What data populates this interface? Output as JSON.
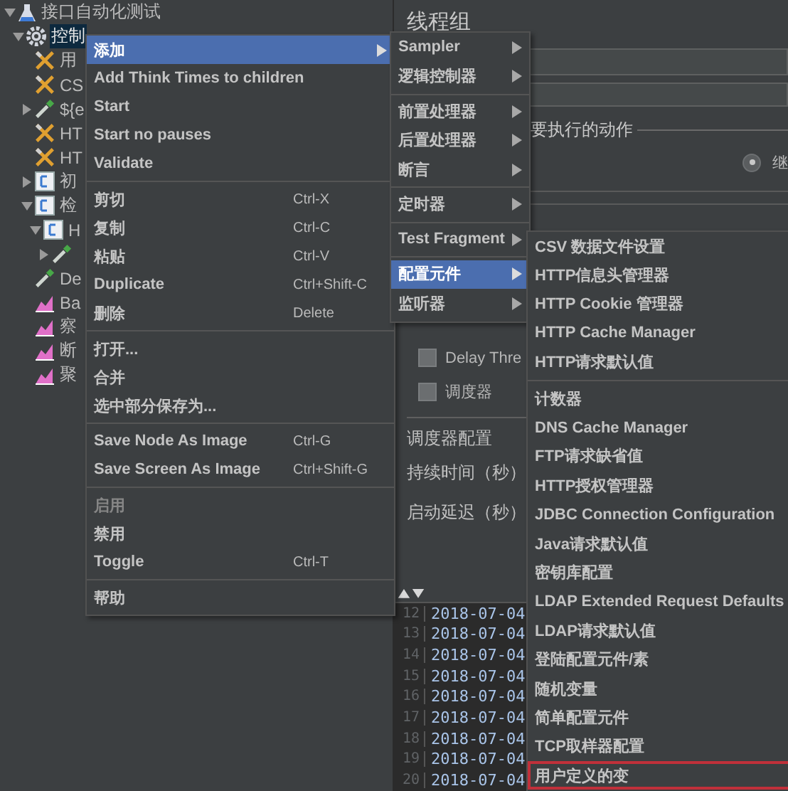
{
  "tree": [
    {
      "label": "接口自动化测试",
      "kind": "flask",
      "expanded": true,
      "selected": false,
      "children": [
        {
          "label": "控制",
          "kind": "gear",
          "expanded": true,
          "selected": true,
          "children": [
            {
              "label": "用",
              "kind": "tools",
              "selected": false
            },
            {
              "label": "CS",
              "kind": "tools",
              "selected": false
            },
            {
              "label": "${e",
              "kind": "pipette",
              "expanded": false,
              "selected": false
            },
            {
              "label": "HT",
              "kind": "tools",
              "selected": false
            },
            {
              "label": "HT",
              "kind": "tools",
              "selected": false
            },
            {
              "label": "初",
              "kind": "controller",
              "expanded": false,
              "selected": false
            },
            {
              "label": "检",
              "kind": "controller",
              "expanded": true,
              "selected": false,
              "children": [
                {
                  "label": "H",
                  "kind": "controller",
                  "expanded": true,
                  "selected": false,
                  "children": [
                    {
                      "kind": "pipette",
                      "expanded": false
                    }
                  ]
                }
              ]
            },
            {
              "label": "De",
              "kind": "pipette",
              "selected": false
            },
            {
              "label": "Ba",
              "kind": "chart",
              "selected": false
            },
            {
              "label": "察",
              "kind": "chart",
              "selected": false
            },
            {
              "label": "断",
              "kind": "chart",
              "selected": false
            },
            {
              "label": "聚",
              "kind": "chart",
              "selected": false
            }
          ]
        }
      ]
    }
  ],
  "panel": {
    "title": "线程组",
    "action_group": "要执行的动作",
    "radio": {
      "label": "继",
      "selected": true
    },
    "options": [
      {
        "label": "Delay Thre",
        "checked": false
      },
      {
        "label": "调度器",
        "checked": false
      }
    ],
    "scheduler_group": "调度器配置",
    "fields": [
      "持续时间（秒）",
      "启动延迟（秒）"
    ]
  },
  "log": [
    {
      "line": "12",
      "text": "2018-07-04"
    },
    {
      "line": "13",
      "text": "2018-07-04"
    },
    {
      "line": "14",
      "text": "2018-07-04"
    },
    {
      "line": "15",
      "text": "2018-07-04"
    },
    {
      "line": "16",
      "text": "2018-07-04"
    },
    {
      "line": "17",
      "text": "2018-07-04"
    },
    {
      "line": "18",
      "text": "2018-07-04"
    },
    {
      "line": "19",
      "text": "2018-07-04"
    },
    {
      "line": "20",
      "text": "2018-07-04"
    }
  ],
  "context_menu": [
    {
      "kind": "submenu",
      "label": "添加",
      "selected": true
    },
    {
      "kind": "item",
      "label": "Add Think Times to children",
      "selected": false
    },
    {
      "kind": "item",
      "label": "Start",
      "selected": false
    },
    {
      "kind": "item",
      "label": "Start no pauses",
      "selected": false
    },
    {
      "kind": "item",
      "label": "Validate",
      "selected": false
    },
    {
      "kind": "separator"
    },
    {
      "kind": "item",
      "label": "剪切",
      "shortcut": "Ctrl-X",
      "selected": false
    },
    {
      "kind": "item",
      "label": "复制",
      "shortcut": "Ctrl-C",
      "selected": false
    },
    {
      "kind": "item",
      "label": "粘贴",
      "shortcut": "Ctrl-V",
      "selected": false
    },
    {
      "kind": "item",
      "label": "Duplicate",
      "shortcut": "Ctrl+Shift-C",
      "selected": false
    },
    {
      "kind": "item",
      "label": "删除",
      "shortcut": "Delete",
      "selected": false
    },
    {
      "kind": "separator"
    },
    {
      "kind": "item",
      "label": "打开...",
      "selected": false
    },
    {
      "kind": "item",
      "label": "合并",
      "selected": false
    },
    {
      "kind": "item",
      "label": "选中部分保存为...",
      "selected": false
    },
    {
      "kind": "separator"
    },
    {
      "kind": "item",
      "label": "Save Node As Image",
      "shortcut": "Ctrl-G",
      "selected": false
    },
    {
      "kind": "item",
      "label": "Save Screen As Image",
      "shortcut": "Ctrl+Shift-G",
      "selected": false
    },
    {
      "kind": "separator"
    },
    {
      "kind": "item",
      "label": "启用",
      "selected": false,
      "disabled": true
    },
    {
      "kind": "item",
      "label": "禁用",
      "selected": false,
      "disabled": false
    },
    {
      "kind": "item",
      "label": "Toggle",
      "shortcut": "Ctrl-T",
      "selected": false
    },
    {
      "kind": "separator"
    },
    {
      "kind": "item",
      "label": "帮助",
      "selected": false
    }
  ],
  "add_menu": [
    {
      "kind": "submenu",
      "label": "Sampler",
      "selected": false
    },
    {
      "kind": "submenu",
      "label": "逻辑控制器",
      "selected": false
    },
    {
      "kind": "separator"
    },
    {
      "kind": "submenu",
      "label": "前置处理器",
      "selected": false
    },
    {
      "kind": "submenu",
      "label": "后置处理器",
      "selected": false
    },
    {
      "kind": "submenu",
      "label": "断言",
      "selected": false
    },
    {
      "kind": "separator"
    },
    {
      "kind": "submenu",
      "label": "定时器",
      "selected": false
    },
    {
      "kind": "separator"
    },
    {
      "kind": "submenu",
      "label": "Test Fragment",
      "selected": false
    },
    {
      "kind": "separator"
    },
    {
      "kind": "submenu",
      "label": "配置元件",
      "selected": true
    },
    {
      "kind": "submenu",
      "label": "监听器",
      "selected": false
    }
  ],
  "config_menu": [
    {
      "kind": "item",
      "label": "CSV 数据文件设置",
      "selected": false
    },
    {
      "kind": "item",
      "label": "HTTP信息头管理器",
      "selected": false
    },
    {
      "kind": "item",
      "label": "HTTP Cookie 管理器",
      "selected": false
    },
    {
      "kind": "item",
      "label": "HTTP Cache Manager",
      "selected": false
    },
    {
      "kind": "item",
      "label": "HTTP请求默认值",
      "selected": false
    },
    {
      "kind": "separator"
    },
    {
      "kind": "item",
      "label": "计数器",
      "selected": false
    },
    {
      "kind": "item",
      "label": "DNS Cache Manager",
      "selected": false
    },
    {
      "kind": "item",
      "label": "FTP请求缺省值",
      "selected": false
    },
    {
      "kind": "item",
      "label": "HTTP授权管理器",
      "selected": false
    },
    {
      "kind": "item",
      "label": "JDBC Connection Configuration",
      "selected": false
    },
    {
      "kind": "item",
      "label": "Java请求默认值",
      "selected": false
    },
    {
      "kind": "item",
      "label": "密钥库配置",
      "selected": false
    },
    {
      "kind": "item",
      "label": "LDAP Extended Request Defaults",
      "selected": false
    },
    {
      "kind": "item",
      "label": "LDAP请求默认值",
      "selected": false
    },
    {
      "kind": "item",
      "label": "登陆配置元件/素",
      "selected": false
    },
    {
      "kind": "item",
      "label": "随机变量",
      "selected": false
    },
    {
      "kind": "item",
      "label": "简单配置元件",
      "selected": false
    },
    {
      "kind": "item",
      "label": "TCP取样器配置",
      "selected": false
    },
    {
      "kind": "item",
      "label": "用户定义的变",
      "selected": false,
      "outlined": true
    }
  ]
}
